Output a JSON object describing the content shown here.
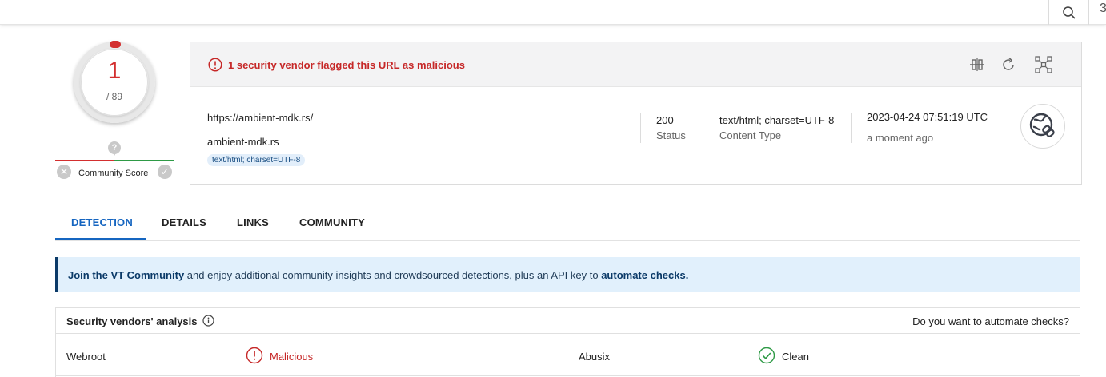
{
  "colors": {
    "malicious": "#c62828",
    "clean": "#2e9a46",
    "accent": "#1565c0",
    "banner_bg": "#e1f0fc"
  },
  "topbar": {
    "search_icon": "search-icon",
    "edge_glyph": "3"
  },
  "score": {
    "detections": "1",
    "total": "/ 89"
  },
  "community": {
    "pin_glyph": "?",
    "label": "Community Score",
    "down_glyph": "✕",
    "up_glyph": "✓"
  },
  "alert": {
    "text": "1 security vendor flagged this URL as malicious",
    "icon": "alert-circle-icon"
  },
  "toolbar": {
    "compare_icon": "compare-icon",
    "reanalyze_icon": "reanalyze-icon",
    "graph_icon": "graph-icon"
  },
  "summary": {
    "url": "https://ambient-mdk.rs/",
    "domain": "ambient-mdk.rs",
    "tag": "text/html; charset=UTF-8",
    "status_value": "200",
    "status_label": "Status",
    "content_type_value": "text/html; charset=UTF-8",
    "content_type_label": "Content Type",
    "date_value": "2023-04-24 07:51:19 UTC",
    "date_relative": "a moment ago",
    "avatar_icon": "globe-link-icon"
  },
  "tabs": [
    {
      "label": "DETECTION",
      "active": true
    },
    {
      "label": "DETAILS",
      "active": false
    },
    {
      "label": "LINKS",
      "active": false
    },
    {
      "label": "COMMUNITY",
      "active": false
    }
  ],
  "banner": {
    "link1": "Join the VT Community",
    "middle": " and enjoy additional community insights and crowdsourced detections, plus an API key to ",
    "link2": "automate checks."
  },
  "vendors": {
    "title": "Security vendors' analysis",
    "automate": "Do you want to automate checks?",
    "rows": [
      {
        "vendor1": "Webroot",
        "result1": "Malicious",
        "vendor2": "Abusix",
        "result2": "Clean"
      }
    ]
  }
}
